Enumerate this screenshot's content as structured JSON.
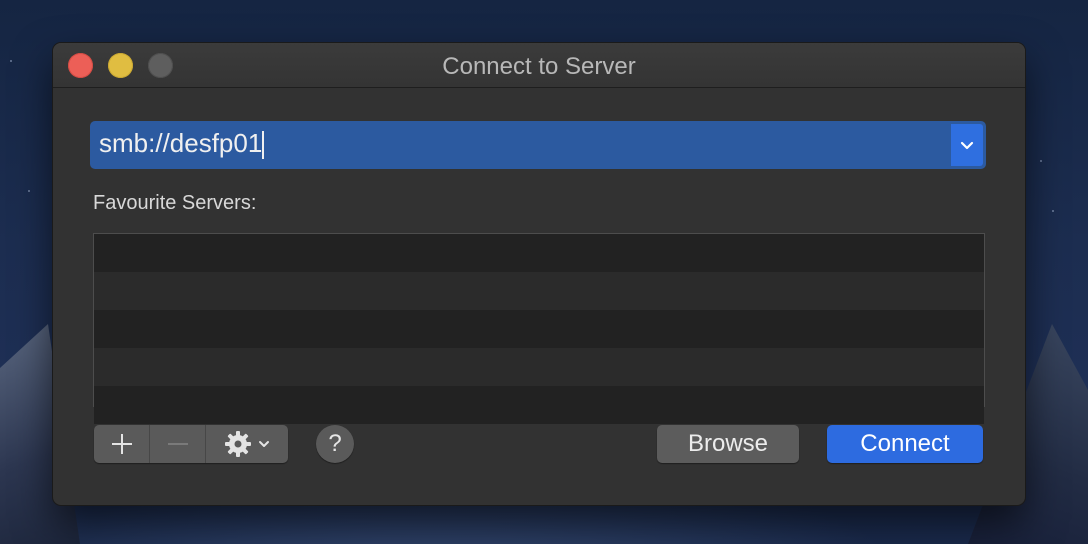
{
  "window": {
    "title": "Connect to Server",
    "traffic_lights": [
      "close",
      "minimize",
      "zoom"
    ]
  },
  "address": {
    "value": "smb://desfp01",
    "dropdown_icon": "chevron-down-icon"
  },
  "favourites": {
    "label": "Favourite Servers:",
    "items": []
  },
  "toolbar": {
    "add_icon": "plus-icon",
    "remove_icon": "minus-icon",
    "action_icon": "gear-icon",
    "help_label": "?"
  },
  "buttons": {
    "browse_label": "Browse",
    "connect_label": "Connect"
  },
  "colors": {
    "accent": "#2d6be0",
    "close": "#ec5f57",
    "minimize": "#e0bd41",
    "zoom_disabled": "#5e5e5e"
  }
}
